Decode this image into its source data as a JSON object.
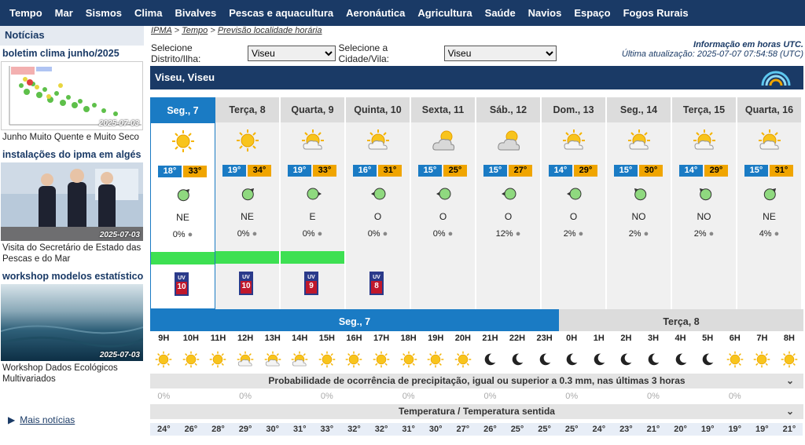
{
  "nav": [
    "Tempo",
    "Mar",
    "Sismos",
    "Clima",
    "Bivalves",
    "Pescas e aquacultura",
    "Aeronáutica",
    "Agricultura",
    "Saúde",
    "Navios",
    "Espaço",
    "Fogos Rurais"
  ],
  "sidebar": {
    "header": "Notícias",
    "items": [
      {
        "title": "boletim clima junho/2025",
        "date": "2025-07-03",
        "caption": "Junho Muito Quente e Muito Seco"
      },
      {
        "title": "instalações do ipma em algés",
        "date": "2025-07-03",
        "caption": "Visita do Secretário de Estado das Pescas e do Mar"
      },
      {
        "title": "workshop modelos estatísticos",
        "date": "2025-07-03",
        "caption": "Workshop Dados Ecológicos Multivariados"
      }
    ],
    "more": "Mais notícias"
  },
  "breadcrumb": {
    "a": "IPMA",
    "b": "Tempo",
    "c": "Previsão localidade horária",
    "sep": ">"
  },
  "selectors": {
    "district_label": "Selecione Distrito/Ilha:",
    "district_value": "Viseu",
    "city_label": "Selecione a Cidade/Vila:",
    "city_value": "Viseu"
  },
  "info": {
    "line1": "Informação em horas UTC.",
    "line2": "Última atualização: 2025-07-07 07:54:58 (UTC)"
  },
  "location": "Viseu, Viseu",
  "days": [
    {
      "name": "Seg., 7",
      "min": "18°",
      "max": "33°",
      "icon": "sun",
      "wind": "NE",
      "precip": "0%"
    },
    {
      "name": "Terça, 8",
      "min": "19°",
      "max": "34°",
      "icon": "sun",
      "wind": "NE",
      "precip": "0%"
    },
    {
      "name": "Quarta, 9",
      "min": "19°",
      "max": "33°",
      "icon": "sun-cloud",
      "wind": "E",
      "precip": "0%"
    },
    {
      "name": "Quinta, 10",
      "min": "16°",
      "max": "31°",
      "icon": "sun-cloud",
      "wind": "O",
      "precip": "0%"
    },
    {
      "name": "Sexta, 11",
      "min": "15°",
      "max": "25°",
      "icon": "cloud-sun",
      "wind": "O",
      "precip": "0%"
    },
    {
      "name": "Sáb., 12",
      "min": "15°",
      "max": "27°",
      "icon": "cloud-sun",
      "wind": "O",
      "precip": "12%"
    },
    {
      "name": "Dom., 13",
      "min": "14°",
      "max": "29°",
      "icon": "sun-cloud",
      "wind": "O",
      "precip": "2%"
    },
    {
      "name": "Seg., 14",
      "min": "15°",
      "max": "30°",
      "icon": "sun-cloud",
      "wind": "NO",
      "precip": "2%"
    },
    {
      "name": "Terça, 15",
      "min": "14°",
      "max": "29°",
      "icon": "sun-cloud",
      "wind": "NO",
      "precip": "2%"
    },
    {
      "name": "Quarta, 16",
      "min": "15°",
      "max": "31°",
      "icon": "sun-cloud",
      "wind": "NE",
      "precip": "4%"
    }
  ],
  "uv": [
    "10",
    "10",
    "9",
    "8"
  ],
  "hourly": {
    "day1": "Seg., 7",
    "day2": "Terça, 8",
    "hours": [
      "9H",
      "10H",
      "11H",
      "12H",
      "13H",
      "14H",
      "15H",
      "16H",
      "17H",
      "18H",
      "19H",
      "20H",
      "21H",
      "22H",
      "23H",
      "0H",
      "1H",
      "2H",
      "3H",
      "4H",
      "5H",
      "6H",
      "7H",
      "8H"
    ],
    "icons": [
      "sun",
      "sun",
      "sun",
      "sun-cloud",
      "sun-cloud",
      "sun-cloud",
      "sun",
      "sun",
      "sun",
      "sun",
      "sun",
      "sun",
      "moon",
      "moon",
      "moon",
      "moon",
      "moon",
      "moon",
      "moon",
      "moon",
      "moon",
      "sun",
      "sun",
      "sun"
    ],
    "precip_title": "Probabilidade de ocorrência de precipitação, igual ou superior a 0.3 mm, nas últimas 3 horas",
    "precip": [
      "0%",
      "",
      "",
      "0%",
      "",
      "",
      "0%",
      "",
      "",
      "0%",
      "",
      "",
      "0%",
      "",
      "",
      "0%",
      "",
      "",
      "0%",
      "",
      "",
      "0%",
      "",
      ""
    ],
    "temp_title": "Temperatura / Temperatura sentida",
    "temps": [
      "24°",
      "26°",
      "28°",
      "29°",
      "30°",
      "31°",
      "33°",
      "32°",
      "32°",
      "31°",
      "30°",
      "27°",
      "26°",
      "25°",
      "25°",
      "25°",
      "24°",
      "23°",
      "21°",
      "20°",
      "19°",
      "19°",
      "19°",
      "21°"
    ]
  },
  "colors": {
    "nav": "#1a3a66",
    "selected": "#1a7bc4",
    "min": "#1a7bc4",
    "max": "#f0a500",
    "bar": "#3de052"
  }
}
